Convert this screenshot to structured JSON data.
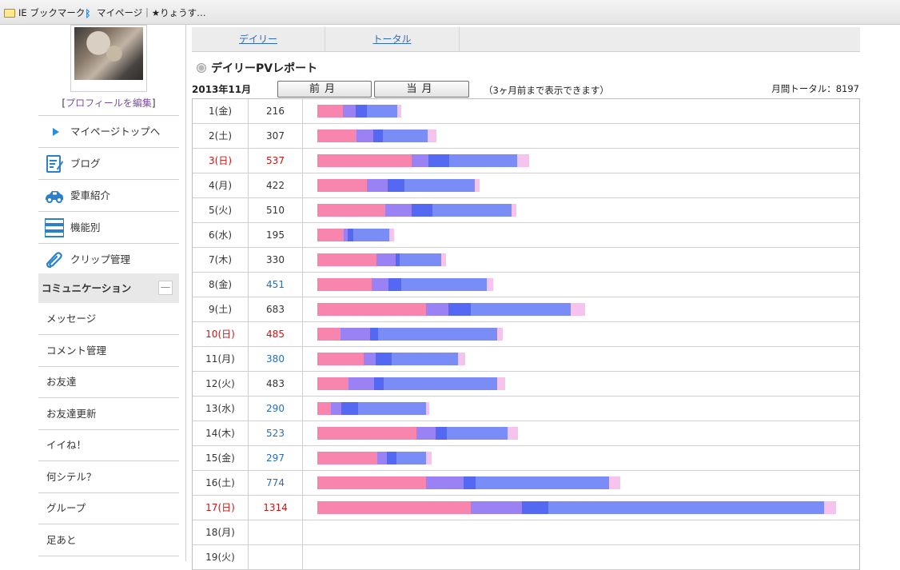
{
  "bookmarks": {
    "ie_bookmarks": "IE ブックマーク",
    "mypage": "マイページ｜★りょうす…"
  },
  "sidebar": {
    "edit_profile_open": "[",
    "edit_profile_link": "プロフィールを編集",
    "edit_profile_close": "]",
    "items": [
      {
        "label": "マイページトップへ",
        "icon": "triangle-right-icon"
      },
      {
        "label": "ブログ",
        "icon": "notepad-icon"
      },
      {
        "label": "愛車紹介",
        "icon": "car-icon"
      },
      {
        "label": "機能別",
        "icon": "stack-icon"
      },
      {
        "label": "クリップ管理",
        "icon": "paperclip-icon"
      }
    ],
    "section": {
      "label": "コミュニケーション",
      "toggle": "—"
    },
    "sub_items": [
      {
        "label": "メッセージ"
      },
      {
        "label": "コメント管理"
      },
      {
        "label": "お友達"
      },
      {
        "label": "お友達更新"
      },
      {
        "label": "イイね！"
      },
      {
        "label": "何シテル？"
      },
      {
        "label": "グループ"
      },
      {
        "label": "足あと"
      }
    ]
  },
  "tabs": [
    {
      "label": "デイリー"
    },
    {
      "label": "トータル"
    }
  ],
  "report": {
    "title": "デイリーPVレポート",
    "month": "2013年11月",
    "prev_button": "前月",
    "current_button": "当月",
    "note": "（3ヶ月前まで表示できます）",
    "monthly_total": "月間トータル：8197"
  },
  "colors": {
    "weekday_text": "#333333",
    "sunday_text": "#c41818",
    "pv_blue": "#2a6eb5",
    "bar_segments": [
      "#f785ad",
      "#9a82f5",
      "#5468f1",
      "#7a8df7",
      "#f6c3ef"
    ]
  },
  "chart_data": {
    "type": "bar",
    "categories": [
      "1(金)",
      "2(土)",
      "3(日)",
      "4(月)",
      "5(火)",
      "6(水)",
      "7(木)",
      "8(金)",
      "9(土)",
      "10(日)",
      "11(月)",
      "12(火)",
      "13(水)",
      "14(木)",
      "15(金)",
      "16(土)",
      "17(日)",
      "18(月)",
      "19(火)"
    ],
    "pv_labels": [
      "216",
      "307",
      "537",
      "422",
      "510",
      "195",
      "330",
      "451",
      "683",
      "485",
      "380",
      "483",
      "290",
      "523",
      "297",
      "774",
      "1314",
      "",
      ""
    ],
    "values": [
      216,
      307,
      537,
      422,
      510,
      195,
      330,
      451,
      683,
      485,
      380,
      483,
      290,
      523,
      297,
      774,
      1314,
      null,
      null
    ],
    "stacked_segments": [
      [
        63,
        31,
        28,
        75,
        9
      ],
      [
        98,
        42,
        23,
        112,
        21
      ],
      [
        236,
        42,
        52,
        170,
        30
      ],
      [
        124,
        52,
        42,
        176,
        11
      ],
      [
        170,
        66,
        52,
        198,
        11
      ],
      [
        66,
        9,
        14,
        89,
        12
      ],
      [
        147,
        47,
        9,
        104,
        12
      ],
      [
        136,
        42,
        32,
        214,
        16
      ],
      [
        271,
        56,
        56,
        250,
        35
      ],
      [
        58,
        74,
        19,
        297,
        13
      ],
      [
        115,
        30,
        40,
        166,
        17
      ],
      [
        77,
        64,
        24,
        284,
        19
      ],
      [
        33,
        26,
        42,
        169,
        8
      ],
      [
        247,
        48,
        28,
        152,
        25
      ],
      [
        150,
        24,
        24,
        74,
        14
      ],
      [
        272,
        94,
        30,
        334,
        28
      ],
      [
        384,
        128,
        66,
        690,
        30
      ],
      [],
      []
    ],
    "sunday_rows": [
      "3(日)",
      "10(日)",
      "17(日)"
    ],
    "blue_pv_rows": [
      "8(金)",
      "11(月)",
      "13(水)",
      "14(木)",
      "15(金)",
      "16(土)"
    ]
  }
}
